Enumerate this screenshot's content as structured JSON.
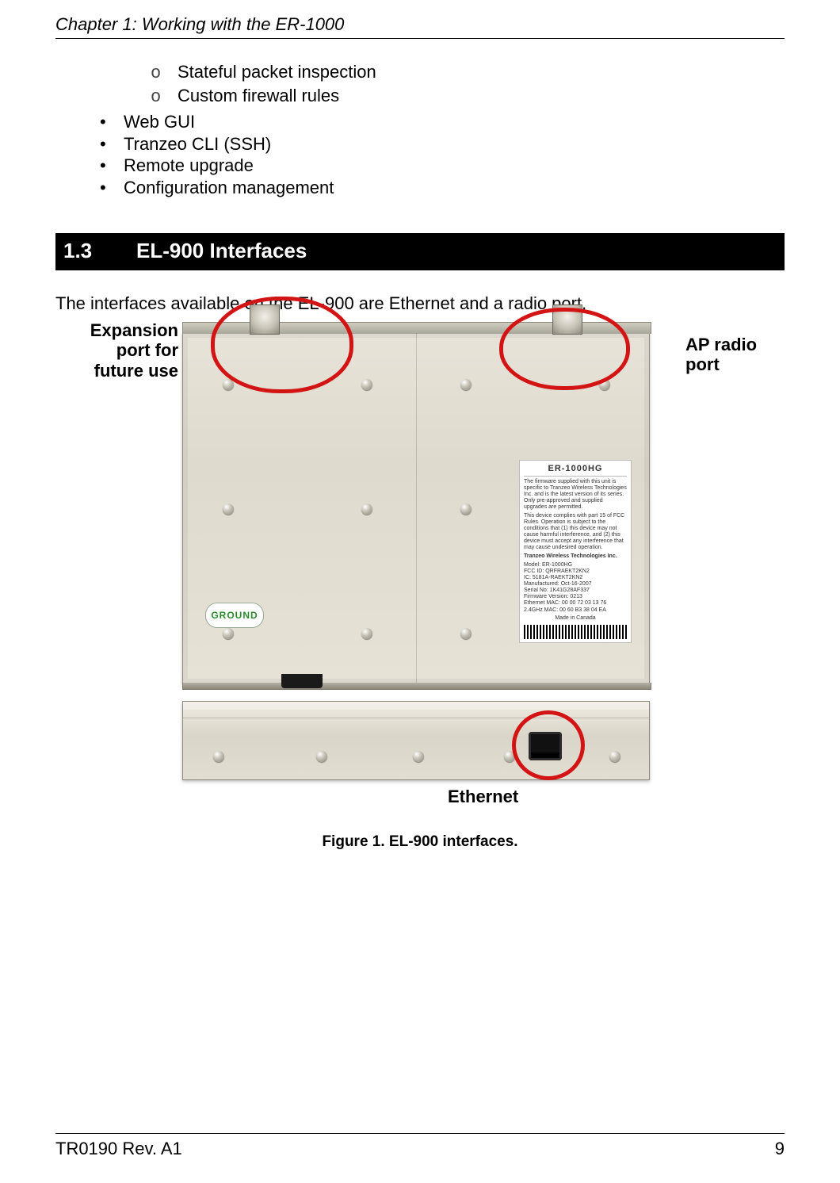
{
  "header": {
    "chapter_line": "Chapter 1: Working with the ER-1000"
  },
  "lists": {
    "sub_items": [
      "Stateful packet inspection",
      "Custom firewall rules"
    ],
    "bullet_items": [
      "Web GUI",
      "Tranzeo CLI (SSH)",
      "Remote upgrade",
      "Configuration management"
    ]
  },
  "section": {
    "number": "1.3",
    "title": "EL-900 Interfaces"
  },
  "intro_text": "The interfaces available on the EL-900 are Ethernet and a radio port.",
  "callouts": {
    "left_line1": "Expansion",
    "left_line2": "port for",
    "left_line3": "future use",
    "right_line1": "AP radio",
    "right_line2": "port",
    "ethernet": "Ethernet"
  },
  "device_labels": {
    "ground": "GROUND",
    "spec": {
      "title": "ER-1000HG",
      "para1": "The firmware supplied with this unit is specific to Tranzeo Wireless Technologies Inc. and is the latest version of its series. Only pre-approved and supplied upgrades are permitted.",
      "para2": "This device complies with part 15 of FCC Rules. Operation is subject to the conditions that (1) this device may not cause harmful interference, and (2) this device must accept any interference that may cause undesired operation.",
      "company": "Tranzeo Wireless Technologies Inc.",
      "model": "Model: ER-1000HG",
      "fcc": "FCC ID: QRFRAEKT2KN2",
      "ic": "IC: 5181A-RAEKT2KN2",
      "mfg": "Manufactured: Oct-16-2007",
      "serial": "Serial No: 1K41G28AF337",
      "fw": "Firmware Version: 0213",
      "eth_mac": "Ethernet MAC: 00 00 72 03 13 76",
      "rf_mac": "2.4GHz MAC: 00 60 B3 38 04 EA",
      "made_in": "Made in Canada"
    }
  },
  "figure": {
    "caption": "Figure 1. EL-900 interfaces."
  },
  "footer": {
    "doc_rev": "TR0190 Rev. A1",
    "page_number": "9"
  }
}
